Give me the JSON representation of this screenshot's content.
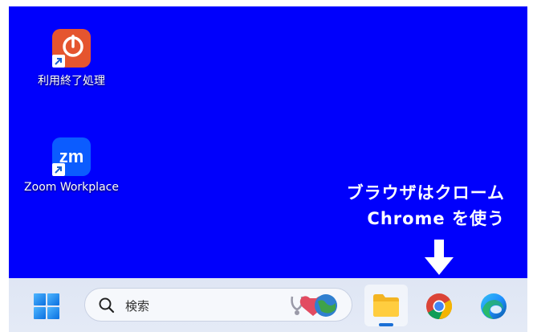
{
  "desktop": {
    "background_color": "#0000fc",
    "icons": [
      {
        "label": "利用終了処理",
        "icon": "power-shutdown-icon",
        "color": "#e5552f"
      },
      {
        "label": "Zoom Workplace",
        "icon": "zoom-workplace-icon",
        "color": "#0b5cff"
      }
    ]
  },
  "annotation": {
    "line1": "ブラウザはクローム",
    "line2": "Chrome を使う",
    "arrow": "arrow-down-icon"
  },
  "taskbar": {
    "start_icon": "windows-start-icon",
    "search": {
      "placeholder": "検索",
      "icon": "search-icon"
    },
    "apps": [
      {
        "name": "File Explorer",
        "icon": "folder-icon",
        "active": true
      },
      {
        "name": "Google Chrome",
        "icon": "chrome-icon",
        "active": false
      },
      {
        "name": "Microsoft Edge",
        "icon": "edge-icon",
        "active": false
      }
    ]
  }
}
